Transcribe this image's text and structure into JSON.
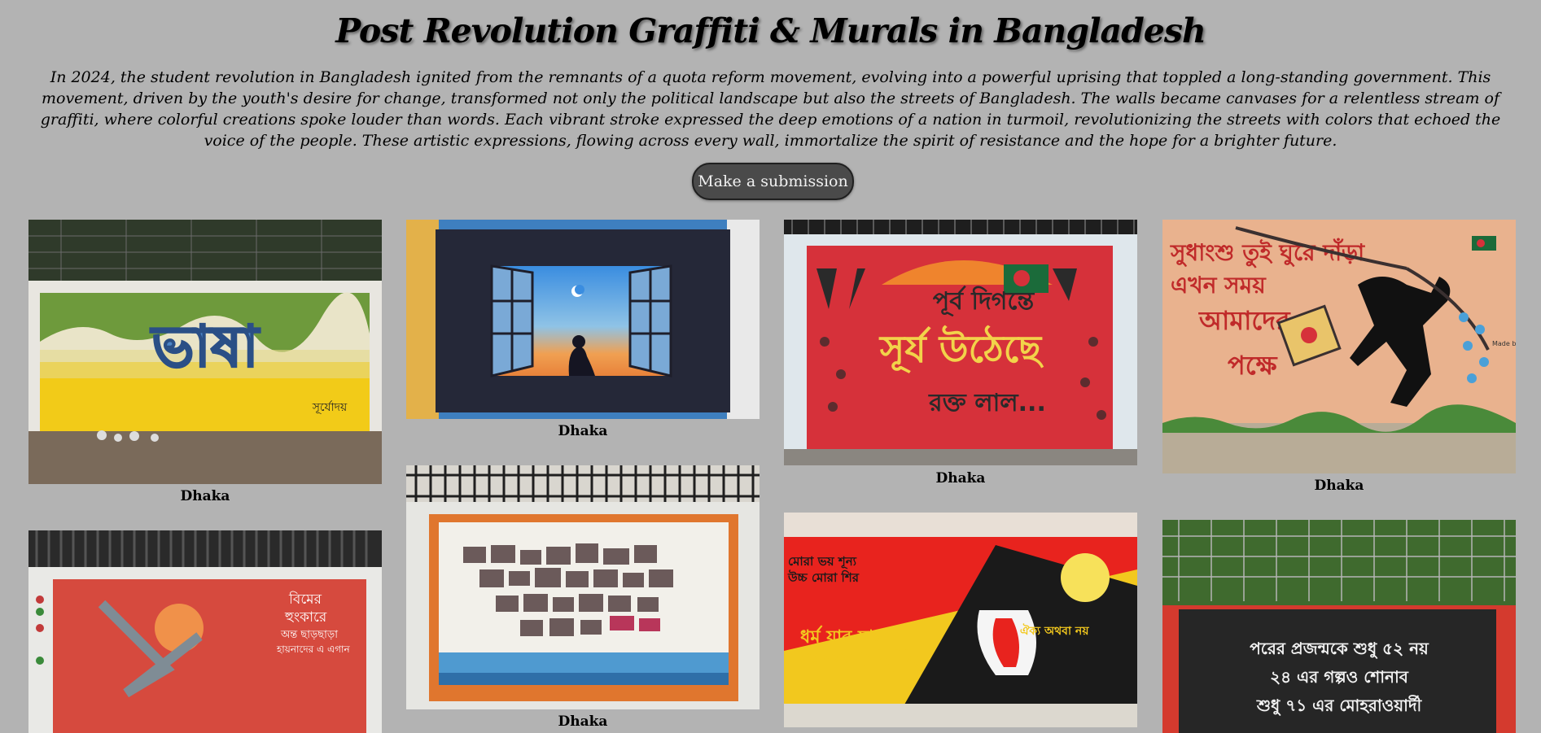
{
  "page": {
    "title": "Post Revolution Graffiti & Murals in Bangladesh",
    "intro": "In 2024, the student revolution in Bangladesh ignited from the remnants of a quota reform movement, evolving into a powerful uprising that toppled a long-standing government. This movement, driven by the youth's desire for change, transformed not only the political landscape but also the streets of Bangladesh. The walls became canvases for a relentless stream of graffiti, where colorful creations spoke louder than words. Each vibrant stroke expressed the deep emotions of a nation in turmoil, revolutionizing the streets with colors that echoed the voice of the people. These artistic expressions, flowing across every wall, immortalize the spirit of resistance and the hope for a brighter future.",
    "submit_label": "Make a submission"
  },
  "gallery": [
    {
      "caption": "Dhaka",
      "photo_text": "ভাষা",
      "signature": "সূর্যোদয়"
    },
    {
      "caption": "Dhaka"
    },
    {
      "caption": "Dhaka",
      "photo_text": [
        "পূর্ব দিগন্তে",
        "সূর্য উঠেছে",
        "রক্ত লাল..."
      ]
    },
    {
      "caption": "Dhaka",
      "photo_text": [
        "সুধাংশু তুই ঘুরে দাঁড়া",
        "এখন সময়",
        "আমাদের",
        "পক্ষে"
      ],
      "signature": "Made by Sanin"
    },
    {
      "caption": "",
      "photo_text": [
        "বিমের",
        "হুংকারে",
        "অন্ত ছাড়ছাড়া",
        "হায়নাদের এ এগান"
      ]
    },
    {
      "caption": "Dhaka"
    },
    {
      "caption": "",
      "photo_text": [
        "মোরা ভয় শূন্য",
        "উচ্চ মোরা শির",
        "ধর্ম যার যার",
        "রাষ্ট্র সবার",
        "সবার",
        "ঐক্য অথবা নয়"
      ]
    },
    {
      "caption": "",
      "photo_text": [
        "পরের প্রজন্মকে শুধু ৫২ নয়",
        "২৪ এর গল্পও শোনাব",
        "শুধু ৭১ এর মোহরাওয়ার্দী"
      ]
    }
  ],
  "colors": {
    "background": "#b3b3b3",
    "button_bg": "#4a4a4a",
    "button_text": "#f0f0f0"
  }
}
